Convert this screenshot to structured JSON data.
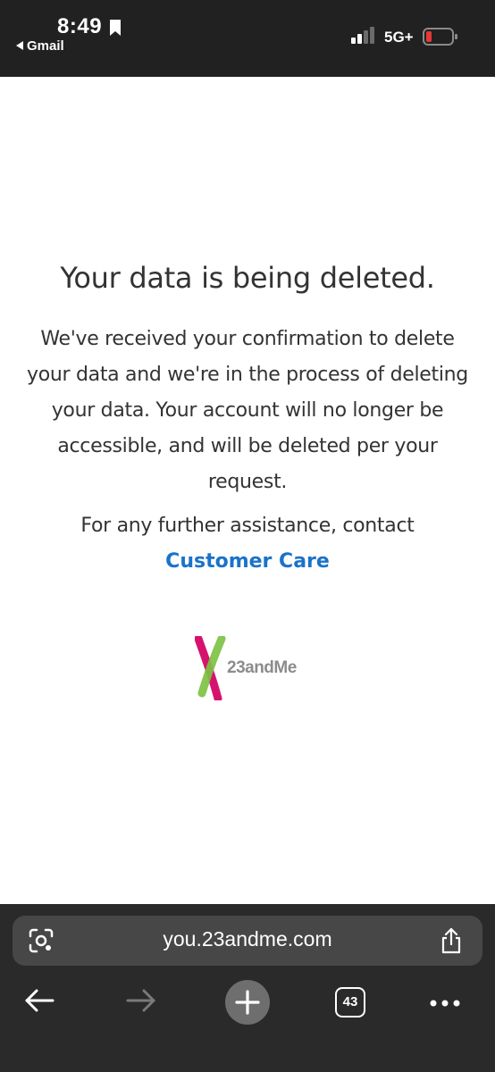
{
  "status_bar": {
    "time": "8:49",
    "back_app": "Gmail",
    "network": "5G+"
  },
  "message": {
    "heading": "Your data is being deleted.",
    "body": "We've received your confirmation to delete your data and we're in the process of deleting your data. Your account will no longer be accessible, and will be deleted per your request.",
    "assist": "For any further assistance, contact",
    "link": "Customer Care",
    "link_color": "#1a73c8"
  },
  "logo": {
    "text": "23andMe",
    "colors": {
      "pink": "#d6126e",
      "green": "#7dc243",
      "gray": "#8c8c8c"
    }
  },
  "browser": {
    "url": "you.23andme.com",
    "tab_count": "43"
  },
  "icons": [
    "bookmark-icon",
    "signal-icon",
    "battery-icon",
    "lens-icon",
    "share-icon",
    "back-arrow-icon",
    "forward-arrow-icon",
    "plus-icon",
    "more-icon"
  ]
}
